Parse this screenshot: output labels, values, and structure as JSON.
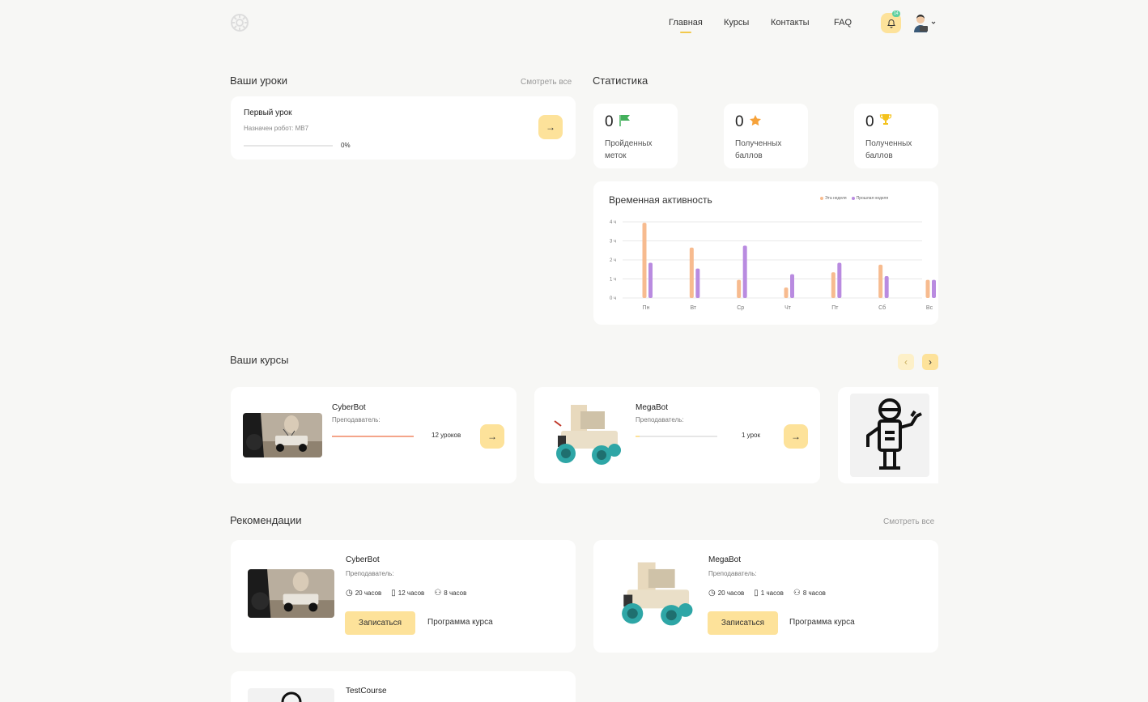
{
  "nav": {
    "items": [
      "Главная",
      "Курсы",
      "Контакты",
      "FAQ"
    ],
    "notification_count": "14"
  },
  "lessons": {
    "title": "Ваши уроки",
    "see_all": "Смотреть все",
    "item": {
      "name": "Первый урок",
      "assigned": "Назначен робот: MB7",
      "progress_label": "0%",
      "progress": 0
    }
  },
  "stats": {
    "title": "Статистика",
    "cards": [
      {
        "value": "0",
        "label1": "Пройденных",
        "label2": "меток",
        "icon": "flag-icon"
      },
      {
        "value": "0",
        "label1": "Полученных",
        "label2": "баллов",
        "icon": "star-icon"
      },
      {
        "value": "0",
        "label1": "Полученных",
        "label2": "баллов",
        "icon": "trophy-icon"
      }
    ]
  },
  "chart_data": {
    "type": "bar",
    "title": "Временная активность",
    "categories": [
      "Пн",
      "Вт",
      "Ср",
      "Чт",
      "Пт",
      "Сб",
      "Вс"
    ],
    "series": [
      {
        "name": "Эта неделя",
        "color": "#f7bb8f",
        "values": [
          3.95,
          2.65,
          0.95,
          0.55,
          1.35,
          1.75,
          0.95
        ]
      },
      {
        "name": "Прошлая неделя",
        "color": "#b98be0",
        "values": [
          1.85,
          1.55,
          2.75,
          1.25,
          1.85,
          1.15,
          0.95
        ]
      }
    ],
    "yticks": [
      "0 ч",
      "1 ч",
      "2 ч",
      "3 ч",
      "4 ч"
    ],
    "ylim": [
      0,
      4
    ],
    "grid": true,
    "legend": "top-right"
  },
  "courses": {
    "title": "Ваши курсы",
    "prev": "‹",
    "next": "›",
    "items": [
      {
        "name": "CyberBot",
        "teacher": "Преподаватель:",
        "lessons": "12 уроков",
        "progress": 1.0,
        "color": "#f4a58a"
      },
      {
        "name": "MegaBot",
        "teacher": "Преподаватель:",
        "lessons": "1 урок",
        "progress": 0.05,
        "color": "#fde29a"
      }
    ]
  },
  "recommendations": {
    "title": "Рекомендации",
    "see_all": "Смотреть все",
    "enroll": "Записаться",
    "program": "Программа курса",
    "items": [
      {
        "name": "CyberBot",
        "teacher": "Преподаватель:",
        "h1": "20 часов",
        "h2": "12 часов",
        "h3": "8 часов"
      },
      {
        "name": "MegaBot",
        "teacher": "Преподаватель:",
        "h1": "20 часов",
        "h2": "1 часов",
        "h3": "8 часов"
      },
      {
        "name": "TestCourse"
      }
    ]
  }
}
